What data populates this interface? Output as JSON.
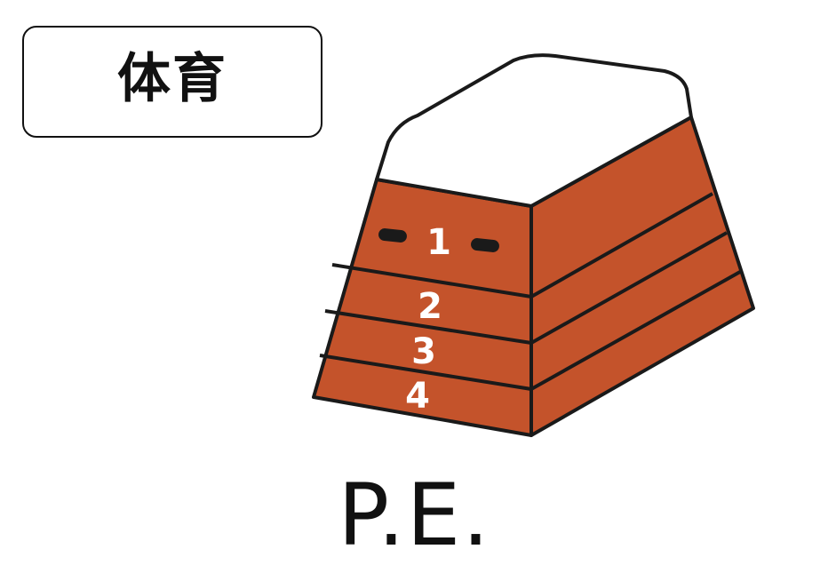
{
  "label": {
    "japanese": "体育"
  },
  "illustration": {
    "icon": "vaulting-box-icon",
    "tiers": [
      "1",
      "2",
      "3",
      "4"
    ],
    "colors": {
      "wood": "#C4532B",
      "top_pad": "#FFFFFF",
      "outline": "#1A1A1A",
      "handle": "#1A1A1A"
    }
  },
  "english": {
    "word": "P.E."
  }
}
